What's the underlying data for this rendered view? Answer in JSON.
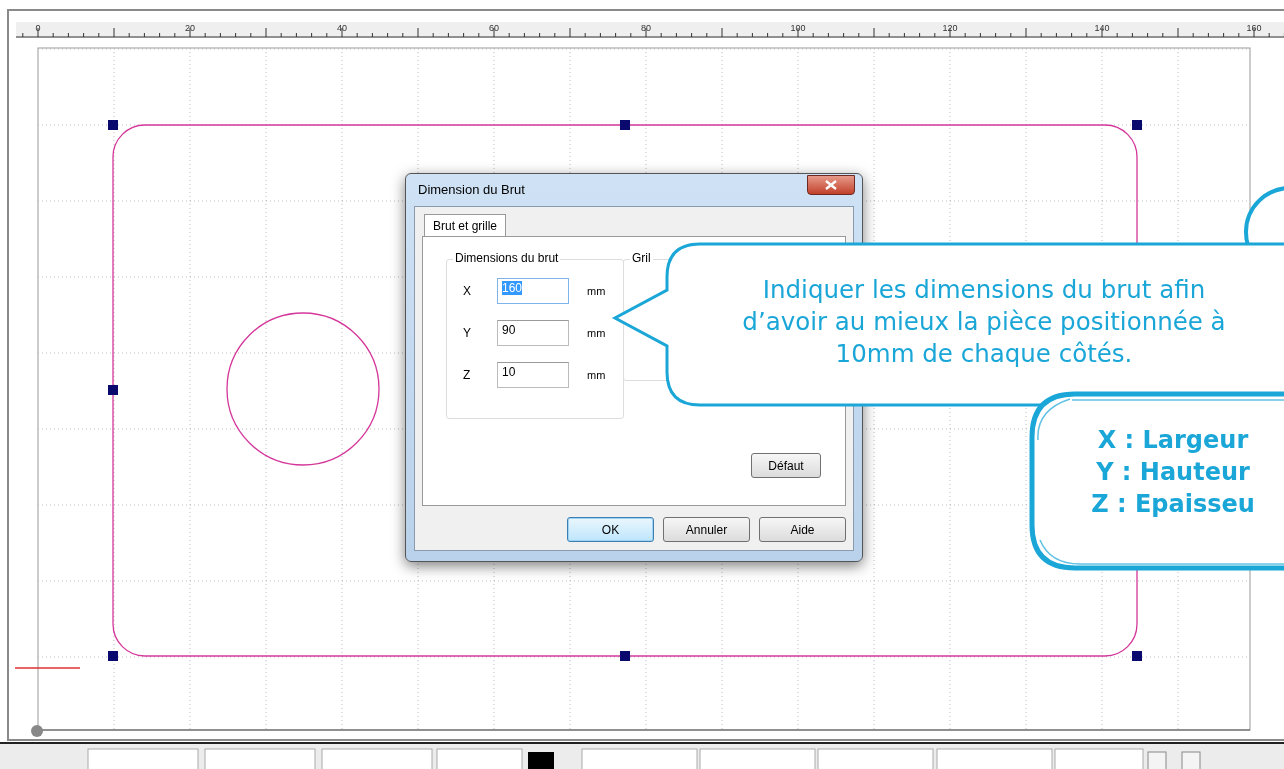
{
  "ruler": {
    "labels": [
      "0",
      "20",
      "40",
      "60",
      "80",
      "100",
      "120",
      "140",
      "160"
    ]
  },
  "dialog": {
    "title": "Dimension du Brut",
    "tabs": [
      {
        "label": "Brut et grille",
        "selected": true
      }
    ],
    "groups": [
      {
        "legend": "Dimensions du brut",
        "fields": [
          {
            "label": "X",
            "value": "160",
            "unit": "mm",
            "highlighted": true
          },
          {
            "label": "Y",
            "value": "90",
            "unit": "mm",
            "highlighted": false
          },
          {
            "label": "Z",
            "value": "10",
            "unit": "mm",
            "highlighted": false
          }
        ]
      },
      {
        "legend": "Gril"
      }
    ],
    "panel_button": {
      "label": "Défaut"
    },
    "buttons": [
      {
        "label": "OK",
        "default": true
      },
      {
        "label": "Annuler",
        "default": false
      },
      {
        "label": "Aide",
        "default": false
      }
    ]
  },
  "callouts": [
    {
      "kind": "bubble",
      "lines": [
        "Indiquer les dimensions du brut afin",
        "d’avoir au mieux la pièce positionnée à",
        "10mm de chaque côtés."
      ]
    },
    {
      "kind": "brush",
      "lines": [
        "X : Largeur",
        "Y : Hauteur",
        "Z : Epaisseu"
      ]
    }
  ]
}
